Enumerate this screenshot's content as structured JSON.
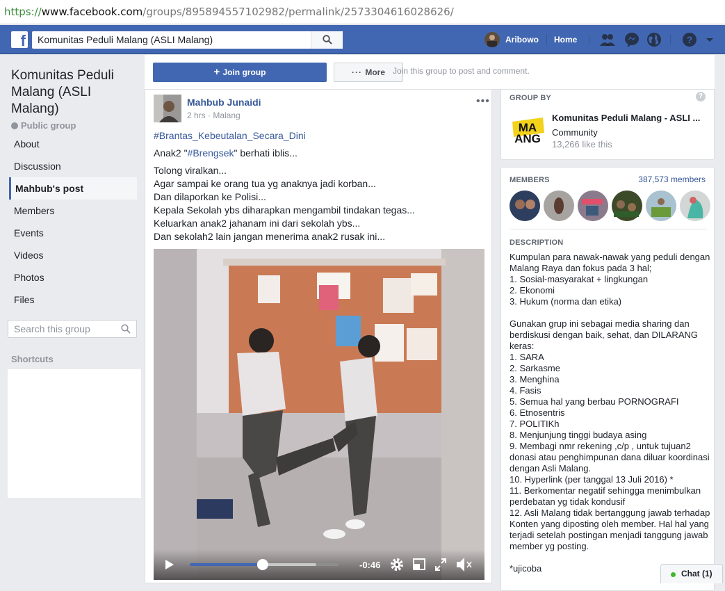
{
  "browser": {
    "url_scheme": "https://",
    "url_host": "www.facebook.com",
    "url_path": "/groups/895894557102982/permalink/2573304616028626/"
  },
  "topbar": {
    "search_value": "Komunitas Peduli Malang (ASLI Malang)",
    "user_name": "Aribowo",
    "home_label": "Home",
    "color": "#4267b2"
  },
  "left": {
    "group_name": "Komunitas Peduli Malang (ASLI Malang)",
    "privacy": "Public group",
    "nav": [
      "About",
      "Discussion",
      "Mahbub's post",
      "Members",
      "Events",
      "Videos",
      "Photos",
      "Files"
    ],
    "search_placeholder": "Search this group",
    "shortcuts_label": "Shortcuts"
  },
  "joinbar": {
    "join_label": "Join group",
    "more_label": "More",
    "hint": "Join this group to post and comment."
  },
  "post": {
    "author": "Mahbub Junaidi",
    "meta": "2 hrs · Malang",
    "hashtag": "#Brantas_Kebeutalan_Secara_Dini",
    "line1_pre": "Anak2 \"",
    "line1_tag": "#Brengsek",
    "line1_post": "\" berhati iblis...",
    "body": [
      "Tolong viralkan...",
      "Agar sampai ke orang tua yg anaknya jadi korban...",
      "Dan dilaporkan ke Polisi...",
      "Kepala Sekolah ybs diharapkan mengambil tindakan tegas...",
      "Keluarkan anak2 jahanam ini dari sekolah ybs...",
      "Dan sekolah2 lain jangan menerima anak2 rusak ini..."
    ],
    "video": {
      "time_remaining": "-0:46",
      "progress": 0.49,
      "buffered": 0.85
    }
  },
  "groupby": {
    "heading": "GROUP BY",
    "name": "Komunitas Peduli Malang - ASLI ...",
    "type": "Community",
    "likes": "13,266 like this"
  },
  "members": {
    "heading": "MEMBERS",
    "count": "387,573 members"
  },
  "description": {
    "heading": "DESCRIPTION",
    "text": "Kumpulan para nawak-nawak yang peduli dengan Malang Raya dan fokus pada 3 hal;\n1. Sosial-masyarakat + lingkungan\n2. Ekonomi\n3. Hukum (norma dan etika)\n\nGunakan grup ini sebagai media sharing dan berdiskusi dengan baik, sehat, dan DILARANG keras:\n1. SARA\n2. Sarkasme\n3. Menghina\n4. Fasis\n5. Semua hal yang berbau PORNOGRAFI\n6. Etnosentris\n7. POLITIKh\n8. Menjunjung tinggi budaya asing\n9. Membagi nmr rekening ,c/p , untuk tujuan2 donasi atau penghimpunan dana diluar koordinasi dengan Asli Malang.\n10. Hyperlink (per tanggal 13 Juli 2016) *\n11. Berkomentar negatif sehingga menimbulkan perdebatan yg tidak kondusif\n12. Asli Malang tidak bertanggung jawab terhadap Konten yang diposting oleh member. Hal hal yang terjadi setelah postingan menjadi tanggung jawab member yg posting.\n\n*ujicoba"
  },
  "chat": {
    "label": "Chat (1)"
  }
}
